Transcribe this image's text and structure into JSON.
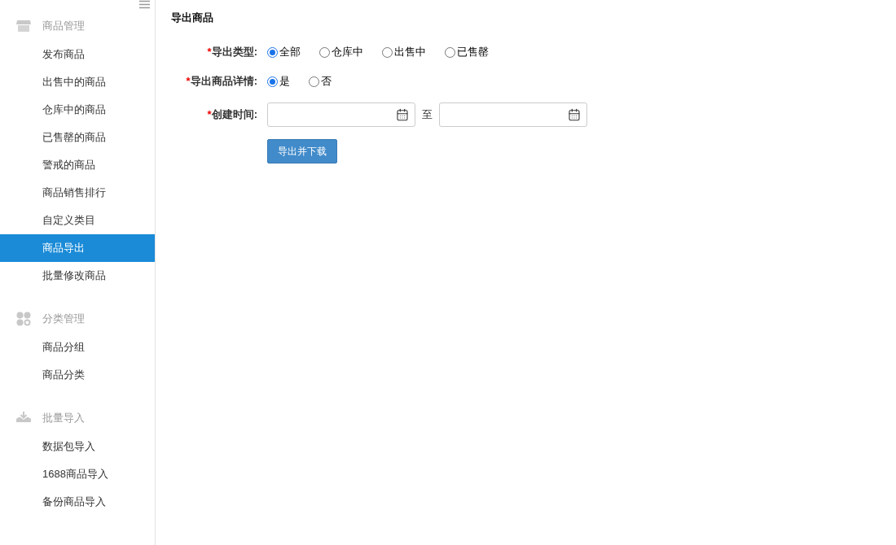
{
  "sidebar": {
    "groups": [
      {
        "kind": "store",
        "title": "商品管理",
        "items": [
          {
            "label": "发布商品",
            "selected": false
          },
          {
            "label": "出售中的商品",
            "selected": false
          },
          {
            "label": "仓库中的商品",
            "selected": false
          },
          {
            "label": "已售罄的商品",
            "selected": false
          },
          {
            "label": "警戒的商品",
            "selected": false
          },
          {
            "label": "商品销售排行",
            "selected": false
          },
          {
            "label": "自定义类目",
            "selected": false
          },
          {
            "label": "商品导出",
            "selected": true
          },
          {
            "label": "批量修改商品",
            "selected": false
          }
        ]
      },
      {
        "kind": "apps",
        "title": "分类管理",
        "items": [
          {
            "label": "商品分组",
            "selected": false
          },
          {
            "label": "商品分类",
            "selected": false
          }
        ]
      },
      {
        "kind": "import",
        "title": "批量导入",
        "items": [
          {
            "label": "数据包导入",
            "selected": false
          },
          {
            "label": "1688商品导入",
            "selected": false
          },
          {
            "label": "备份商品导入",
            "selected": false
          }
        ]
      }
    ]
  },
  "page_title": "导出商品",
  "form": {
    "export_type": {
      "required_mark": "*",
      "label": "导出类型:",
      "options": [
        {
          "label": "全部",
          "selected": true
        },
        {
          "label": "仓库中",
          "selected": false
        },
        {
          "label": "出售中",
          "selected": false
        },
        {
          "label": "已售罄",
          "selected": false
        }
      ]
    },
    "export_details": {
      "required_mark": "*",
      "label": "导出商品详情:",
      "options": [
        {
          "label": "是",
          "selected": true
        },
        {
          "label": "否",
          "selected": false
        }
      ]
    },
    "created_time": {
      "required_mark": "*",
      "label": "创建时间:",
      "separator": "至"
    },
    "submit": "导出并下载"
  }
}
